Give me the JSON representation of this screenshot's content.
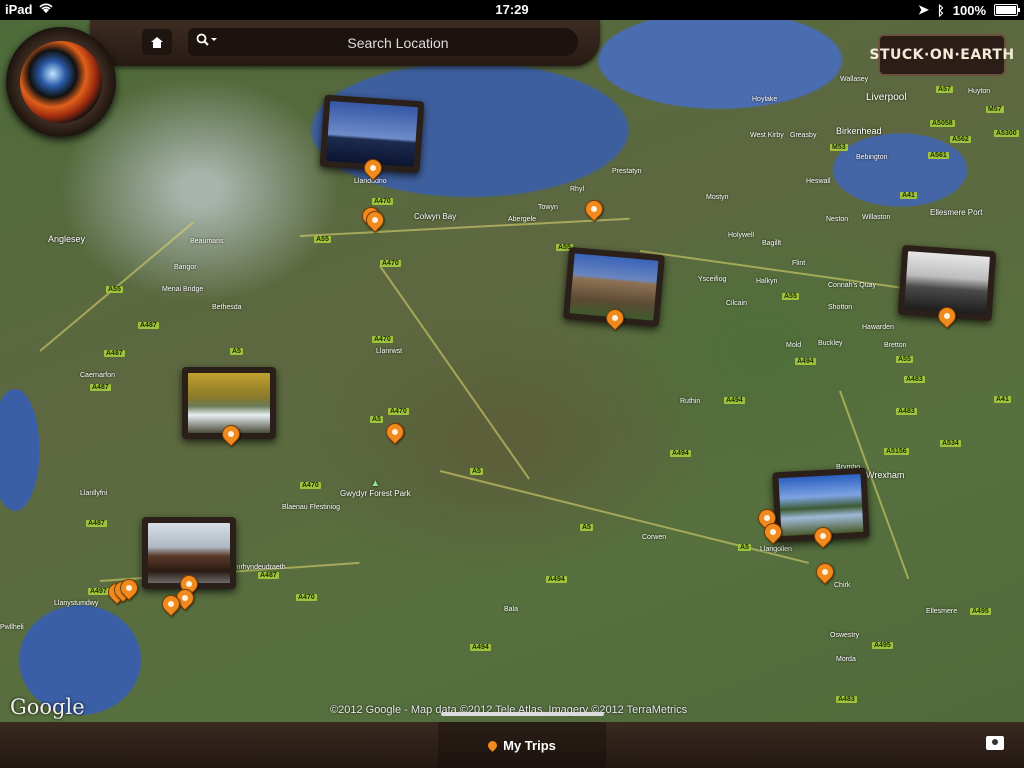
{
  "status_bar": {
    "device": "iPad",
    "time": "17:29",
    "battery": "100%"
  },
  "header": {
    "search_placeholder": "Search Location"
  },
  "brand": {
    "logo_text": "STUCK·ON·EARTH"
  },
  "map": {
    "labels": {
      "liverpool": "Liverpool",
      "birkenhead": "Birkenhead",
      "wallasey": "Wallasey",
      "west_kirby": "West Kirby",
      "bebington": "Bebington",
      "heswall": "Heswall",
      "ellesmere_port": "Ellesmere Port",
      "neston": "Neston",
      "willaston": "Willaston",
      "prestatyn": "Prestatyn",
      "rhyl": "Rhyl",
      "towyn": "Towyn",
      "abergele": "Abergele",
      "colwyn_bay": "Colwyn Bay",
      "llandudno": "Llandudno",
      "mostyn": "Mostyn",
      "holywell": "Holywell",
      "bagillt": "Bagillt",
      "flint": "Flint",
      "connahs_quay": "Connah's Quay",
      "shotton": "Shotton",
      "hawarden": "Hawarden",
      "buckley": "Buckley",
      "mold": "Mold",
      "bretton": "Bretton",
      "ruthin": "Ruthin",
      "brymbo": "Brymbo",
      "wrexham": "Wrexham",
      "corwen": "Corwen",
      "llangollen": "Llangollen",
      "chirk": "Chirk",
      "oswestry": "Oswestry",
      "morda": "Morda",
      "ellesmere": "Ellesmere",
      "bala": "Bala",
      "anglesey": "Anglesey",
      "beaumaris": "Beaumaris",
      "bangor": "Bangor",
      "menai_bridge": "Menai Bridge",
      "bethesda": "Bethesda",
      "caernarfon": "Caernarfon",
      "llanllyfni": "Llanllyfni",
      "llanrwst": "Llanrwst",
      "blaenau": "Blaenau Ffestiniog",
      "penrhyndeudraeth": "Penrhyndeudraeth",
      "llanystumdwy": "Llanystumdwy",
      "pwllheli": "Pwllheli",
      "gwydyr": "Gwydyr Forest Park",
      "ysceifiog": "Ysceifiog",
      "cilcain": "Cilcain",
      "halkyn": "Halkyn",
      "hoylake": "Hoylake",
      "greasby": "Greasby",
      "huyton": "Huyton"
    },
    "attribution": "©2012 Google - Map data ©2012 Tele Atlas, Imagery ©2012 TerraMetrics",
    "google_logo": "Google"
  },
  "bottom_bar": {
    "trips_label": "My Trips"
  }
}
